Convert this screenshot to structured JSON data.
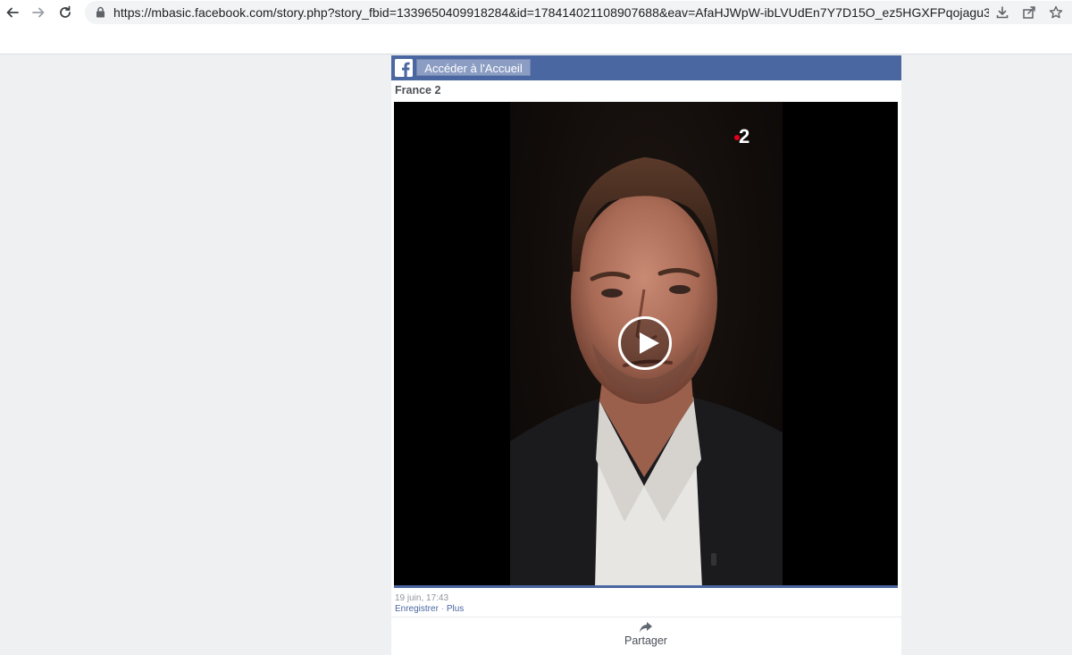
{
  "browser": {
    "url": "https://mbasic.facebook.com/story.php?story_fbid=1339650409918284&id=178414021108907688&eav=AfaHJWpW-ibLVUdEn7Y7D15O_ez5HGXFPqojagu3UcvIMzPn..."
  },
  "header": {
    "home_label": "Accéder à l'Accueil",
    "brand_color": "#4b67a1"
  },
  "post": {
    "author": "France 2",
    "channel_badge": "2",
    "timestamp": "19 juin, 17:43",
    "save_label": "Enregistrer",
    "separator": "·",
    "more_label": "Plus"
  },
  "actions": {
    "share_label": "Partager"
  },
  "icons": [
    "back-icon",
    "forward-icon",
    "reload-icon",
    "lock-icon",
    "download-icon",
    "share-page-icon",
    "star-icon",
    "facebook-logo-icon",
    "play-icon",
    "share-arrow-icon"
  ]
}
